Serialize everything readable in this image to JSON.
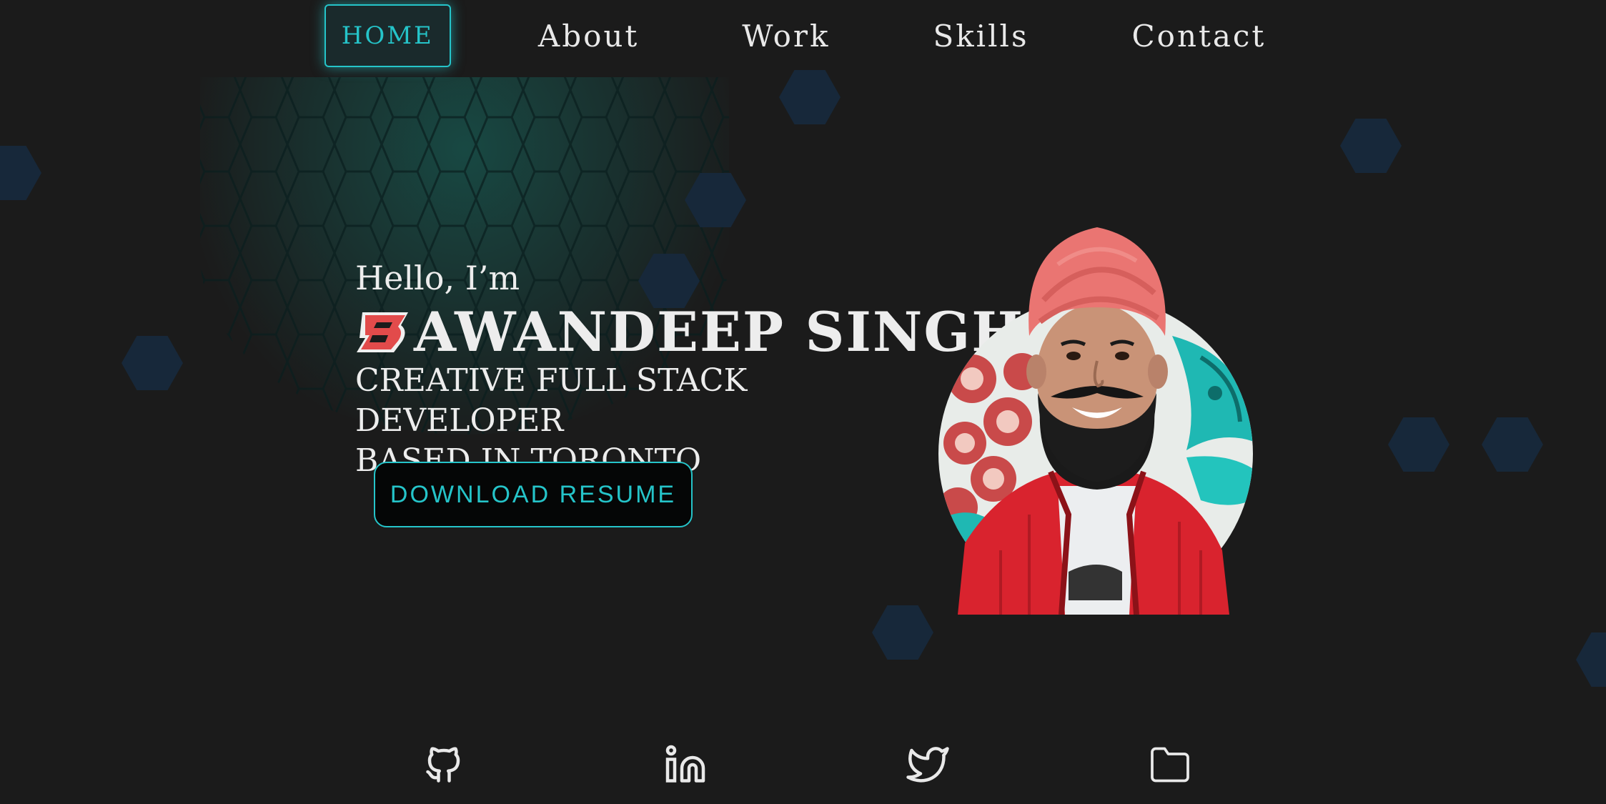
{
  "nav": {
    "items": [
      {
        "label": "HOME",
        "active": true
      },
      {
        "label": "About",
        "active": false
      },
      {
        "label": "Work",
        "active": false
      },
      {
        "label": "Skills",
        "active": false
      },
      {
        "label": "Contact",
        "active": false
      }
    ]
  },
  "hero": {
    "greeting": "Hello, I’m",
    "logo_letter": "B",
    "name": "AWANDEEP SINGH",
    "subtitle_line1": "CREATIVE FULL STACK DEVELOPER",
    "subtitle_line2": "BASED IN TORONTO",
    "download_label": "DOWNLOAD RESUME"
  },
  "social": [
    {
      "icon": "github-icon"
    },
    {
      "icon": "linkedin-icon"
    },
    {
      "icon": "twitter-icon"
    },
    {
      "icon": "folder-icon"
    }
  ],
  "colors": {
    "background": "#1b1b1b",
    "accent": "#25c4c9",
    "text": "#ededed",
    "hex": "#17283a",
    "logo_red": "#e24b4b"
  }
}
